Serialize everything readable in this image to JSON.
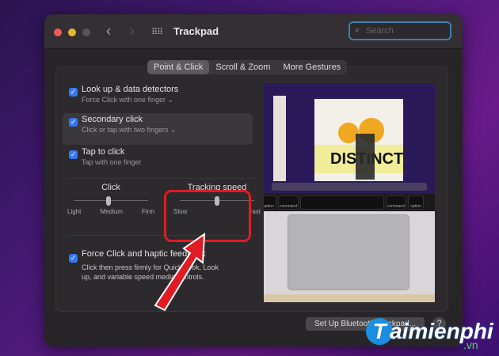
{
  "window": {
    "title": "Trackpad",
    "search_placeholder": "Search"
  },
  "tabs": [
    {
      "label": "Point & Click",
      "active": true
    },
    {
      "label": "Scroll & Zoom"
    },
    {
      "label": "More Gestures"
    }
  ],
  "options": [
    {
      "title": "Look up & data detectors",
      "subtitle": "Force Click with one finger ⌄",
      "checked": true
    },
    {
      "title": "Secondary click",
      "subtitle": "Click or tap with two fingers ⌄",
      "checked": true
    },
    {
      "title": "Tap to click",
      "subtitle": "Tap with one finger",
      "checked": true
    }
  ],
  "click_slider": {
    "label": "Click",
    "labels": [
      "Light",
      "Medium",
      "Firm"
    ],
    "value": "Medium"
  },
  "tracking_slider": {
    "label": "Tracking speed",
    "min_label": "Slow",
    "max_label": "Fast",
    "value_fraction": 0.5
  },
  "force_click": {
    "title": "Force Click and haptic feedback",
    "description": "Click then press firmly for Quick Look, Look up, and variable speed media controls.",
    "checked": true
  },
  "preview": {
    "slide_text": "DISTINCT",
    "keys": [
      "option",
      "command",
      "command",
      "option"
    ]
  },
  "footer": {
    "bluetooth_button": "Set Up Bluetooth Trackpad...",
    "help": "?"
  },
  "watermark": {
    "brand": "aimienphi",
    "letter": "T",
    "tld": ".vn"
  },
  "colors": {
    "accent": "#3478f6",
    "highlight": "#e01b24"
  }
}
